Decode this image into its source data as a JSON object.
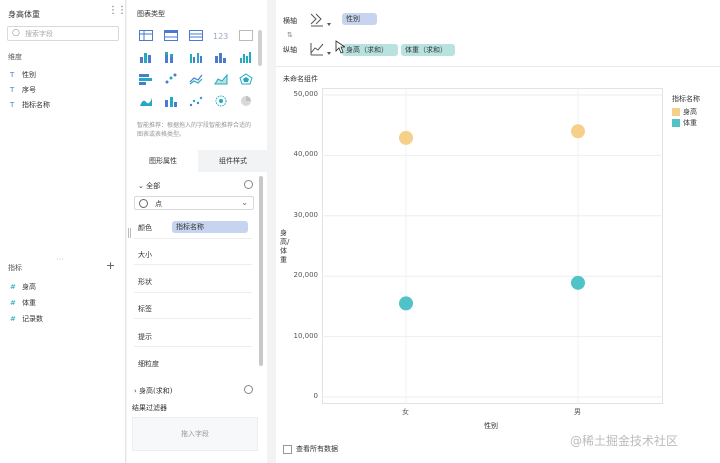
{
  "dataset": {
    "title": "身高体重",
    "more_icon": "more-dots",
    "search_placeholder": "搜索字段"
  },
  "dimensions": {
    "title": "维度",
    "items": [
      {
        "type_icon": "text-field-icon",
        "label": "性别"
      },
      {
        "type_icon": "text-field-icon",
        "label": "序号"
      },
      {
        "type_icon": "text-field-icon",
        "label": "指标名称"
      }
    ]
  },
  "measures": {
    "title": "指标",
    "items": [
      {
        "type_icon": "number-field-icon",
        "label": "身高"
      },
      {
        "type_icon": "number-field-icon",
        "label": "体重"
      },
      {
        "type_icon": "number-field-icon",
        "label": "记录数"
      }
    ]
  },
  "chart_types": {
    "title": "图表类型",
    "hint": "智能推荐：根据拖入的字段智能推荐合适的图表或表格类型。"
  },
  "tabs": [
    "图形属性",
    "组件样式"
  ],
  "attributes": {
    "all_label": "全部",
    "shape_selected": "点",
    "color_label": "颜色",
    "color_field": "指标名称",
    "rows": [
      "大小",
      "形状",
      "标签",
      "提示",
      "细粒度"
    ],
    "height_row": "身高(求和)"
  },
  "filter": {
    "title": "结果过滤器",
    "drop_hint": "拖入字段"
  },
  "axes": {
    "x_label": "横轴",
    "x_field": "性别",
    "y_label": "纵轴",
    "y_fields": [
      "身高（求和）",
      "体重（求和）"
    ]
  },
  "component_title": "未命名组件",
  "check_all": "查看所有数据",
  "watermark": "@稀土掘金技术社区",
  "colors": {
    "height": "#f5d08a",
    "weight": "#4fc3c8",
    "accent_blue": "#c7d4f0",
    "accent_teal": "#b7e2df"
  },
  "chart_data": {
    "type": "scatter",
    "categories": [
      "女",
      "男"
    ],
    "xlabel": "性别",
    "ylabel": "身高/体重",
    "yticks": [
      "50,000",
      "40,000",
      "30,000",
      "20,000",
      "10,000",
      "0"
    ],
    "ylim": [
      0,
      50000
    ],
    "legend_title": "指标名称",
    "legend_position": "top-right",
    "series": [
      {
        "name": "身高",
        "values": [
          42900,
          44000
        ],
        "color": "#f5d08a"
      },
      {
        "name": "体重",
        "values": [
          15500,
          18900
        ],
        "color": "#4fc3c8"
      }
    ]
  }
}
